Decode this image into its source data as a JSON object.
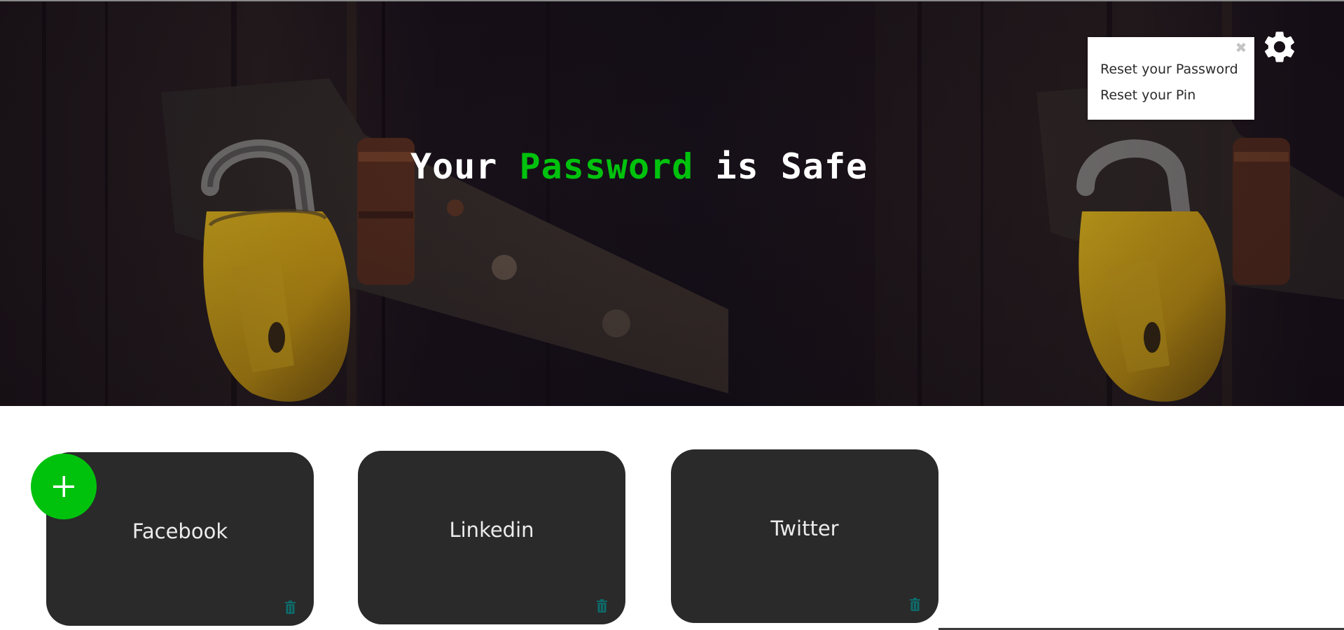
{
  "hero": {
    "title_prefix": "Your ",
    "title_accent": "Password",
    "title_suffix": " is Safe",
    "accent_color": "#00c20d",
    "background": "photo of yellow padlock on dark wooden door"
  },
  "settings": {
    "icon": "gear-icon",
    "popup": {
      "close_icon": "close-icon",
      "close_label": "✖",
      "items": [
        {
          "label": "Reset your Password"
        },
        {
          "label": "Reset your Pin"
        }
      ]
    }
  },
  "add_button": {
    "icon": "plus-icon",
    "color": "#00c20d"
  },
  "cards": [
    {
      "label": "Facebook",
      "delete_icon": "trash-icon"
    },
    {
      "label": "Linkedin",
      "delete_icon": "trash-icon"
    },
    {
      "label": "Twitter",
      "delete_icon": "trash-icon"
    }
  ],
  "colors": {
    "card_background": "#2a2a2a",
    "card_text": "#ececec",
    "trash_icon": "#0e6b6b"
  }
}
